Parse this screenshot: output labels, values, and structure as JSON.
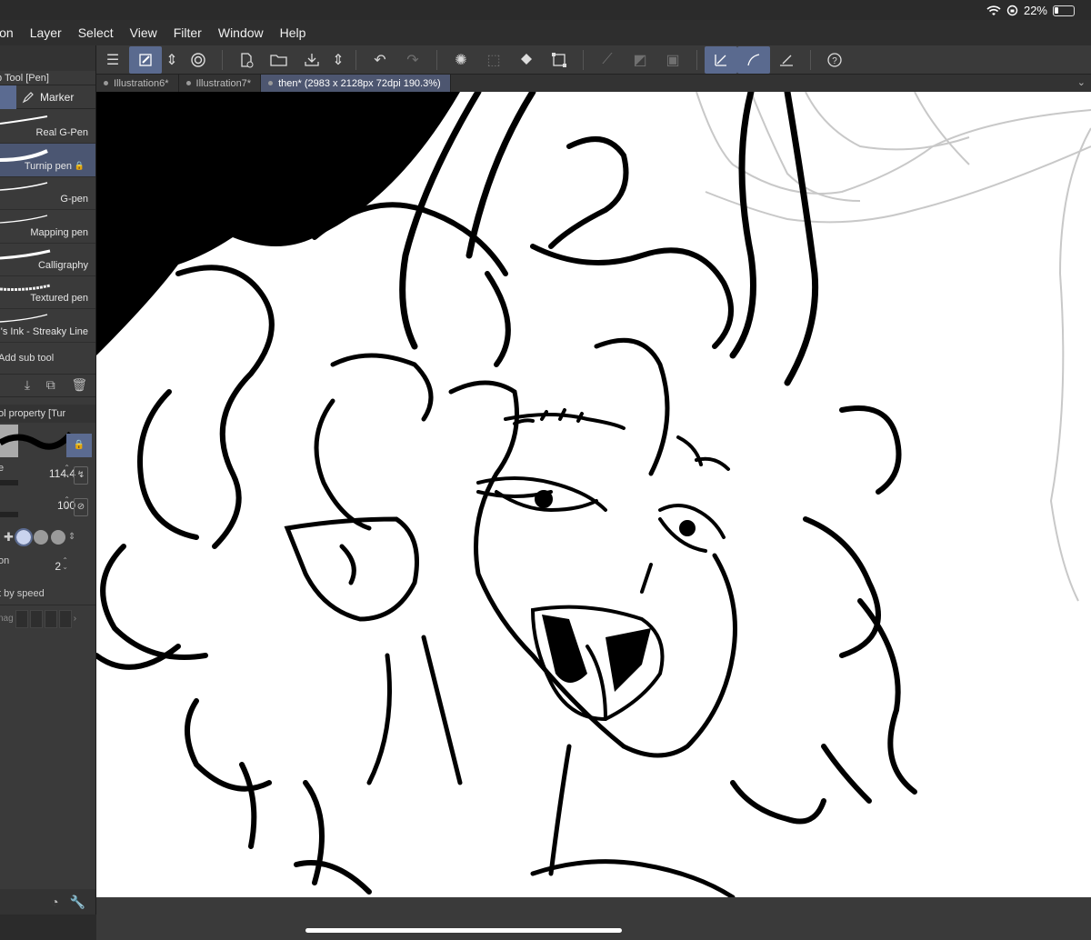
{
  "status": {
    "battery": "22%",
    "wifi_icon": "wifi-icon",
    "battery_icon": "battery-icon"
  },
  "menu": [
    "ion",
    "Layer",
    "Select",
    "View",
    "Filter",
    "Window",
    "Help"
  ],
  "tabs": [
    {
      "label": "Illustration6*"
    },
    {
      "label": "Illustration7*"
    },
    {
      "label": "then* (2983 x 2128px 72dpi 190.3%)"
    }
  ],
  "panel": {
    "title": "b Tool [Pen]",
    "marker_tab": "Marker",
    "brushes": [
      {
        "name": "Real G-Pen"
      },
      {
        "name": "Turnip pen"
      },
      {
        "name": "G-pen"
      },
      {
        "name": "Mapping pen"
      },
      {
        "name": "Calligraphy"
      },
      {
        "name": "Textured pen"
      },
      {
        "name": "'s Ink - Streaky Line"
      }
    ],
    "add_sub_tool": "Add sub tool",
    "property_title": "ol property [Tur",
    "size_label": "e",
    "size_value": "114.4",
    "opacity_value": "100",
    "stab_label": "on",
    "stab_value": "2",
    "speed_label": "t by speed",
    "mag_label": "nag"
  },
  "colors": {
    "accent": "#5b6b91",
    "active_tab": "#4d5670",
    "background": "#2b2b2b"
  }
}
